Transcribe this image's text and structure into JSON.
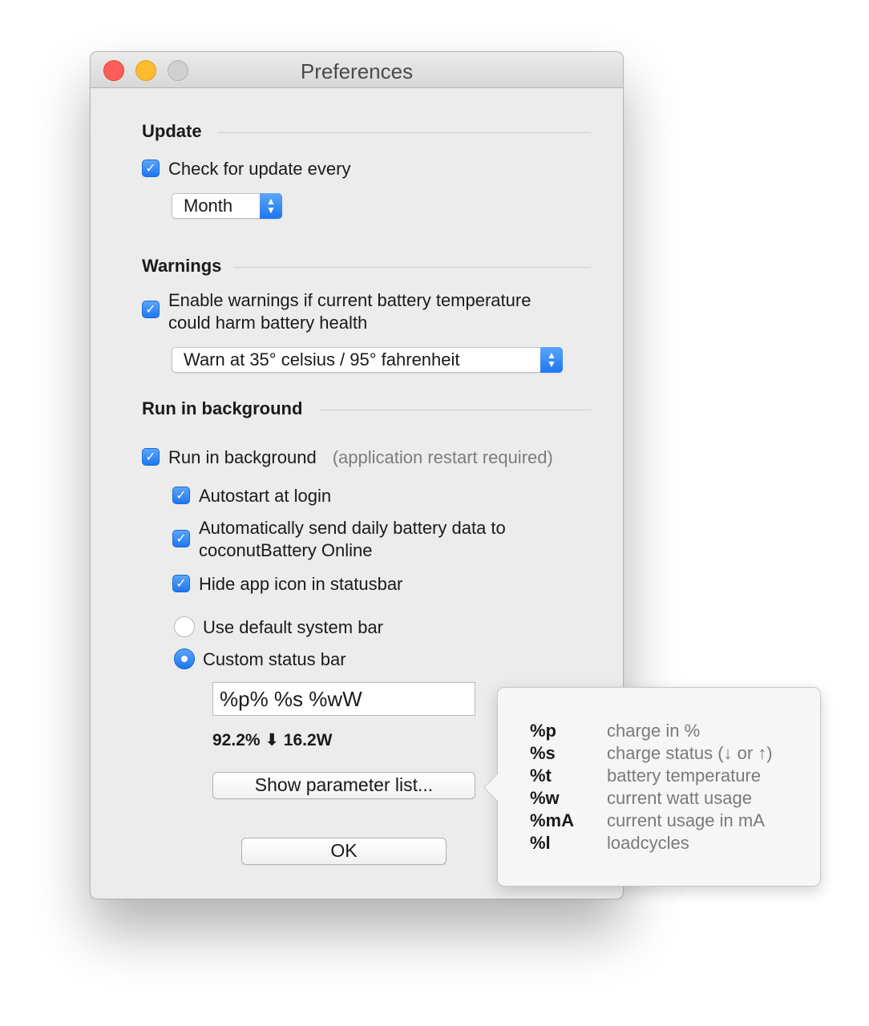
{
  "window": {
    "title": "Preferences"
  },
  "update": {
    "heading": "Update",
    "check_label": "Check for update every",
    "check_checked": true,
    "interval_value": "Month"
  },
  "warnings": {
    "heading": "Warnings",
    "enable_line1": "Enable warnings if current battery temperature",
    "enable_line2": "could harm battery health",
    "enable_checked": true,
    "threshold_value": "Warn at 35° celsius / 95° fahrenheit"
  },
  "background": {
    "heading": "Run in background",
    "run_label": "Run in background",
    "run_checked": true,
    "run_note": "(application restart required)",
    "autostart_label": "Autostart at login",
    "send_line1": "Automatically send daily battery data to",
    "send_line2": "coconutBattery Online",
    "hide_icon_label": "Hide app icon in statusbar",
    "radio_default_label": "Use default system bar",
    "radio_custom_label": "Custom status bar",
    "selected_radio": "custom",
    "format_value": "%p% %s %wW",
    "preview_text": "92.2% ⬇ 16.2W",
    "show_params_label": "Show parameter list..."
  },
  "ok_label": "OK",
  "params": [
    {
      "key": "%p",
      "desc": "charge in %"
    },
    {
      "key": "%s",
      "desc": "charge status (↓ or ↑)"
    },
    {
      "key": "%t",
      "desc": "battery temperature"
    },
    {
      "key": "%w",
      "desc": "current watt usage"
    },
    {
      "key": "%mA",
      "desc": "current usage in mA"
    },
    {
      "key": "%l",
      "desc": "loadcycles"
    }
  ],
  "icons": {
    "close": "close-icon",
    "minimize": "minimize-icon",
    "zoom": "zoom-icon",
    "checkmark": "checkmark-icon",
    "stepper": "chevron-updown-icon"
  },
  "colors": {
    "accent": "#1d77ee",
    "close": "#fc5f57",
    "minimize": "#fdbc2e"
  }
}
